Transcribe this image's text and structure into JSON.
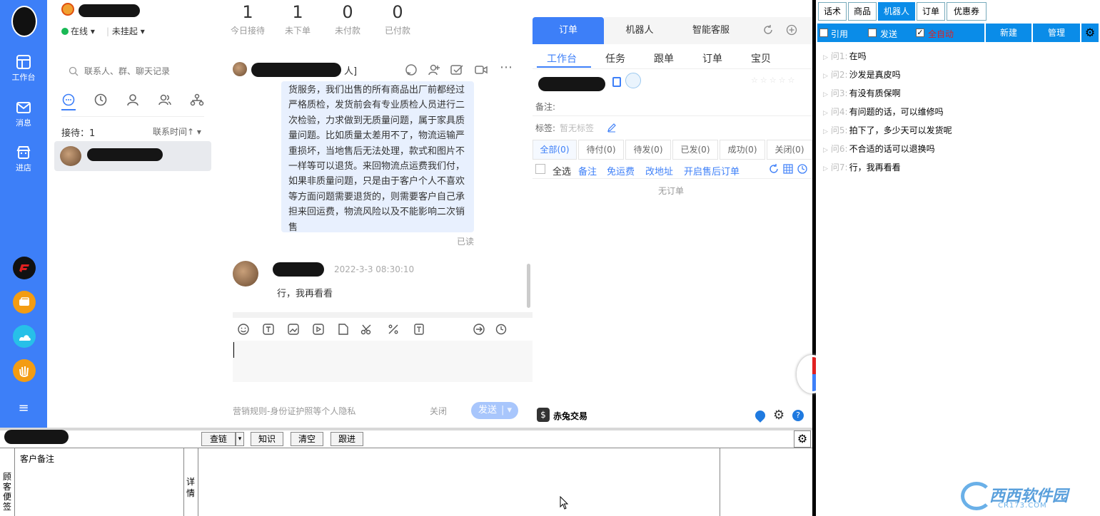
{
  "sidebar": {
    "items": [
      {
        "label": "工作台",
        "icon": "workbench-icon"
      },
      {
        "label": "消息",
        "icon": "message-icon"
      },
      {
        "label": "进店",
        "icon": "shop-icon"
      }
    ],
    "menu_icon": "≡"
  },
  "profile": {
    "status": "在线",
    "hang": "未挂起"
  },
  "stats": [
    {
      "value": "1",
      "label": "今日接待"
    },
    {
      "value": "1",
      "label": "未下单"
    },
    {
      "value": "0",
      "label": "未付款"
    },
    {
      "value": "0",
      "label": "已付款"
    }
  ],
  "contacts": {
    "search_placeholder": "联系人、群、聊天记录",
    "receive_label": "接待：1",
    "sort_label": "联系时间↑"
  },
  "chat": {
    "header_suffix": "人]",
    "bubble_text": "货服务，我们出售的所有商品出厂前都经过严格质检，发货前会有专业质检人员进行二次检验，力求做到无质量问题，属于家具质量问题。比如质量太差用不了，物流运输严重损坏，当地售后无法处理，款式和图片不一样等可以退货。来回物流点运费我们付，如果非质量问题，只是由于客户个人不喜欢等方面问题需要退货的，则需要客户自己承担来回运费，物流风险以及不能影响二次销售",
    "read_status": "已读",
    "message_time": "2022-3-3 08:30:10",
    "message_text": "行，我再看看",
    "rule_text": "营销规则-身份证护照等个人隐私",
    "close_label": "关闭",
    "send_label": "发送"
  },
  "order_panel": {
    "tabs": [
      "订单",
      "机器人",
      "智能客服"
    ],
    "subtabs": [
      "工作台",
      "任务",
      "跟单",
      "订单",
      "宝贝"
    ],
    "note_label": "备注:",
    "tag_label": "标签:",
    "tag_value": "暂无标签",
    "filters": [
      "全部(0)",
      "待付(0)",
      "待发(0)",
      "已发(0)",
      "成功(0)",
      "关闭(0)"
    ],
    "select_all": "全选",
    "actions": [
      "备注",
      "免运费",
      "改地址",
      "开启售后订单"
    ],
    "empty": "无订单",
    "footer_brand": "赤兔交易"
  },
  "robot": {
    "tabs": [
      "话术",
      "商品",
      "机器人",
      "订单",
      "优惠券"
    ],
    "options": [
      "引用",
      "发送",
      "全自动"
    ],
    "buttons": [
      "新建",
      "管理"
    ],
    "questions": [
      {
        "no": "问1:",
        "text": "在吗"
      },
      {
        "no": "问2:",
        "text": "沙发是真皮吗"
      },
      {
        "no": "问3:",
        "text": "有没有质保啊"
      },
      {
        "no": "问4:",
        "text": "有问题的话，可以维修吗"
      },
      {
        "no": "问5:",
        "text": "拍下了，多少天可以发货呢"
      },
      {
        "no": "问6:",
        "text": "不合适的话可以退换吗"
      },
      {
        "no": "问7:",
        "text": "行，我再看看"
      }
    ]
  },
  "bottom": {
    "buttons": [
      "查链",
      "知识",
      "清空",
      "跟进"
    ],
    "left_label": "顾客便签",
    "customer_note": "客户备注",
    "detail_label": "详情"
  },
  "watermark": {
    "text": "西西软件园",
    "sub": "CR173.COM"
  },
  "colors": {
    "accent": "#3d7ff8",
    "robot_blue": "#0a8ce8",
    "red": "#e02020"
  }
}
